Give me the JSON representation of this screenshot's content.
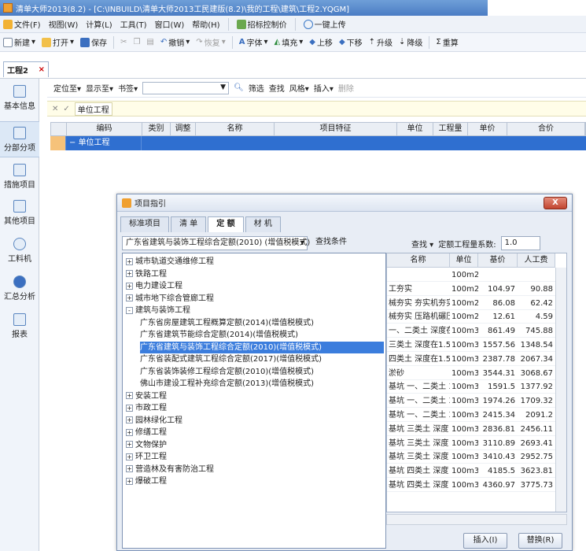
{
  "window": {
    "title": "清单大师2013(8.2) - [C:\\INBUILD\\清单大师2013工民建版(8.2)\\我的工程\\建筑\\工程2.YQGM]"
  },
  "menubar": [
    {
      "label": "文件(F)",
      "icon": "file-icon"
    },
    {
      "label": "视图(W)"
    },
    {
      "label": "计算(L)"
    },
    {
      "label": "工具(T)"
    },
    {
      "label": "窗口(W)"
    },
    {
      "label": "帮助(H)"
    },
    {
      "label": "招标控制价",
      "icon": "bid-icon"
    },
    {
      "label": "一键上传",
      "icon": "upload-icon"
    }
  ],
  "toolbar": [
    {
      "label": "新建",
      "dropdown": true
    },
    {
      "label": "打开",
      "dropdown": true
    },
    {
      "label": "保存"
    },
    {
      "label": "撤销",
      "dropdown": true
    },
    {
      "label": "恢复",
      "dropdown": true,
      "disabled": true
    },
    {
      "label": "字体",
      "dropdown": true
    },
    {
      "label": "填充",
      "dropdown": true
    },
    {
      "label": "上移"
    },
    {
      "label": "下移"
    },
    {
      "label": "升级"
    },
    {
      "label": "降级"
    },
    {
      "label": "重算"
    }
  ],
  "project_tab": {
    "label": "工程2",
    "close": "×"
  },
  "sidebar": [
    {
      "label": "基本信息",
      "icon": "info-icon"
    },
    {
      "label": "分部分项",
      "icon": "list-icon"
    },
    {
      "label": "措施项目",
      "icon": "tree-icon"
    },
    {
      "label": "其他项目",
      "icon": "other-icon"
    },
    {
      "label": "工料机",
      "icon": "gear-icon"
    },
    {
      "label": "汇总分析",
      "icon": "summary-icon"
    },
    {
      "label": "报表",
      "icon": "report-icon"
    }
  ],
  "subtoolbar": {
    "locate": "定位至",
    "show": "显示至",
    "bookmark": "书签",
    "filter": "筛选",
    "find": "查找",
    "style": "风格",
    "insert": "插入",
    "delete": "删除"
  },
  "editbar": {
    "value": "单位工程"
  },
  "grid": {
    "headers": [
      "编码",
      "类别",
      "调整",
      "名称",
      "项目特征",
      "单位",
      "工程量",
      "单价",
      "合价"
    ],
    "row": {
      "code": "单位工程"
    }
  },
  "dialog": {
    "title": "项目指引",
    "close": "X",
    "tabs": [
      "标准项目",
      "清 单",
      "定 额",
      "材 机"
    ],
    "active_tab": 2,
    "quota_select": "广东省建筑与装饰工程综合定额(2010) (增值税模式)",
    "search_condition": "查找条件",
    "find_button": "查找",
    "coef_label": "定额工程量系数:",
    "coef_value": "1.0",
    "tree": [
      {
        "label": "城市轨道交通维修工程",
        "pm": "+",
        "level": 0
      },
      {
        "label": "铁路工程",
        "pm": "+",
        "level": 0
      },
      {
        "label": "电力建设工程",
        "pm": "+",
        "level": 0
      },
      {
        "label": "城市地下综合管廊工程",
        "pm": "+",
        "level": 0
      },
      {
        "label": "建筑与装饰工程",
        "pm": "-",
        "level": 0
      },
      {
        "label": "广东省房屋建筑工程概算定额(2014)(增值税模式)",
        "level": 1
      },
      {
        "label": "广东省建筑节能综合定额(2014)(增值税模式)",
        "level": 1
      },
      {
        "label": "广东省建筑与装饰工程综合定额(2010)(增值税模式)",
        "level": 1,
        "selected": true
      },
      {
        "label": "广东省装配式建筑工程综合定额(2017)(增值税模式)",
        "level": 1
      },
      {
        "label": "广东省装饰装修工程综合定额(2010)(增值税模式)",
        "level": 1
      },
      {
        "label": "佛山市建设工程补充综合定额(2013)(增值税模式)",
        "level": 1
      },
      {
        "label": "安装工程",
        "pm": "+",
        "level": 0
      },
      {
        "label": "市政工程",
        "pm": "+",
        "level": 0
      },
      {
        "label": "园林绿化工程",
        "pm": "+",
        "level": 0
      },
      {
        "label": "修缮工程",
        "pm": "+",
        "level": 0
      },
      {
        "label": "文物保护",
        "pm": "+",
        "level": 0
      },
      {
        "label": "环卫工程",
        "pm": "+",
        "level": 0
      },
      {
        "label": "营造林及有害防治工程",
        "pm": "+",
        "level": 0
      },
      {
        "label": "爆破工程",
        "pm": "+",
        "level": 0
      }
    ],
    "list_headers": [
      "名称",
      "单位",
      "基价",
      "人工费"
    ],
    "list_rows": [
      {
        "name": "",
        "unit": "100m2",
        "price": "",
        "labor": ""
      },
      {
        "name": "工夯实",
        "unit": "100m2",
        "price": "104.97",
        "labor": "90.88"
      },
      {
        "name": "械夯实 夯实机夯实",
        "unit": "100m2",
        "price": "86.08",
        "labor": "62.42"
      },
      {
        "name": "械夯实 压路机碾压",
        "unit": "100m2",
        "price": "12.61",
        "labor": "4.59"
      },
      {
        "name": "一、二类土 深度在1",
        "unit": "100m3",
        "price": "861.49",
        "labor": "745.88"
      },
      {
        "name": "三类土 深度在1.5m",
        "unit": "100m3",
        "price": "1557.56",
        "labor": "1348.54"
      },
      {
        "name": "四类土 深度在1.5m",
        "unit": "100m3",
        "price": "2387.78",
        "labor": "2067.34"
      },
      {
        "name": "淤砂",
        "unit": "100m3",
        "price": "3544.31",
        "labor": "3068.67"
      },
      {
        "name": "基坑 一、二类土 3",
        "unit": "100m3",
        "price": "1591.5",
        "labor": "1377.92"
      },
      {
        "name": "基坑 一、二类土 3",
        "unit": "100m3",
        "price": "1974.26",
        "labor": "1709.32"
      },
      {
        "name": "基坑 一、二类土 3",
        "unit": "100m3",
        "price": "2415.34",
        "labor": "2091.2"
      },
      {
        "name": "基坑 三类土 深度",
        "unit": "100m3",
        "price": "2836.81",
        "labor": "2456.11"
      },
      {
        "name": "基坑 三类土 深度",
        "unit": "100m3",
        "price": "3110.89",
        "labor": "2693.41"
      },
      {
        "name": "基坑 三类土 深度",
        "unit": "100m3",
        "price": "3410.43",
        "labor": "2952.75"
      },
      {
        "name": "基坑 四类土 深度",
        "unit": "100m3",
        "price": "4185.5",
        "labor": "3623.81"
      },
      {
        "name": "基坑 四类土 深度",
        "unit": "100m3",
        "price": "4360.97",
        "labor": "3775.73"
      }
    ],
    "insert_button": "插入(I)",
    "replace_button": "替换(R)"
  }
}
